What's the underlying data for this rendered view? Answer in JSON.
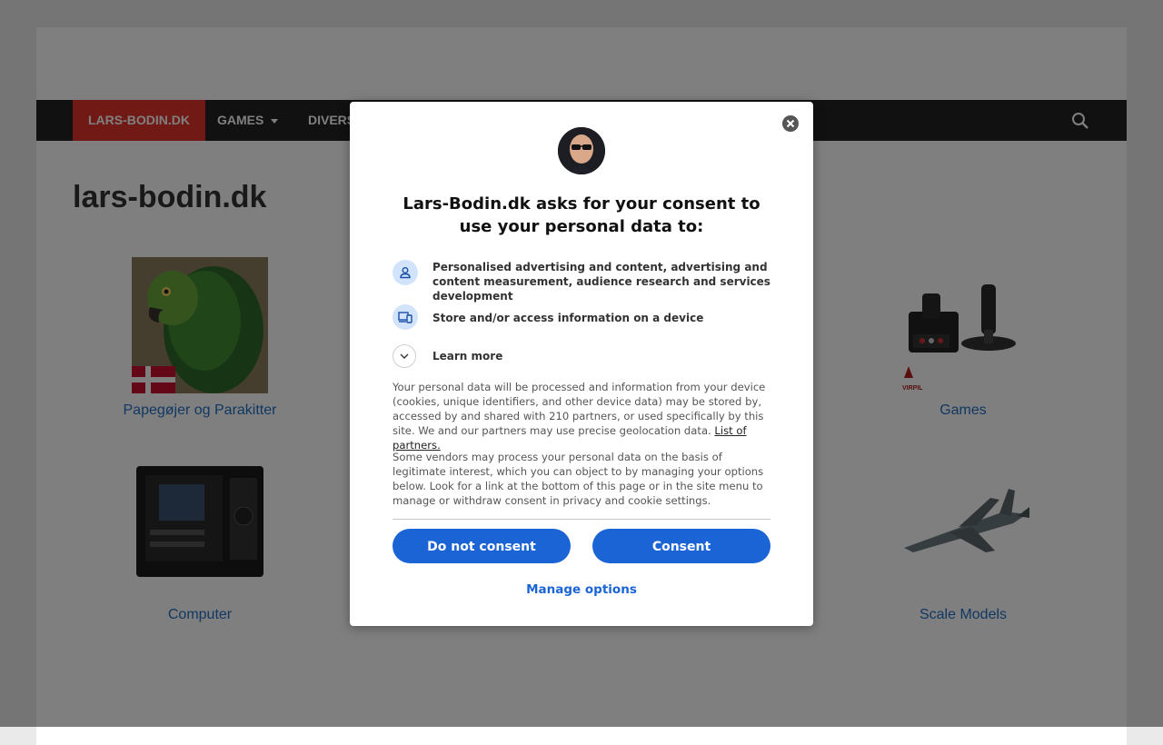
{
  "site": {
    "title": "lars-bodin.dk",
    "nav": {
      "home": "LARS-BODIN.DK",
      "games": "GAMES",
      "divers": "DIVERS"
    },
    "tiles": [
      {
        "label": "Papegøjer og Parakitter"
      },
      {
        "label": "Games"
      },
      {
        "label": "Computer"
      },
      {
        "label": "Scale Models"
      }
    ]
  },
  "consent": {
    "title": "Lars-Bodin.dk asks for your consent to use your personal data to:",
    "purposes": [
      {
        "icon": "person-icon",
        "text": "Personalised advertising and content, advertising and content measurement, audience research and services development"
      },
      {
        "icon": "devices-icon",
        "text": "Store and/or access information on a device"
      }
    ],
    "learn_more": "Learn more",
    "paragraph1": "Your personal data will be processed and information from your device (cookies, unique identifiers, and other device data) may be stored by, accessed by and shared with 210 partners, or used specifically by this site. We and our partners may use precise geolocation data.",
    "partners_link": "List of partners.",
    "paragraph2": "Some vendors may process your personal data on the basis of legitimate interest, which you can object to by managing your options below. Look for a link at the bottom of this page or in the site menu to manage or withdraw consent in privacy and cookie settings.",
    "do_not_consent": "Do not consent",
    "consent": "Consent",
    "manage_options": "Manage options"
  },
  "colors": {
    "accent": "#1a64d6",
    "nav_active": "#e3342b",
    "link": "#2270c4"
  }
}
